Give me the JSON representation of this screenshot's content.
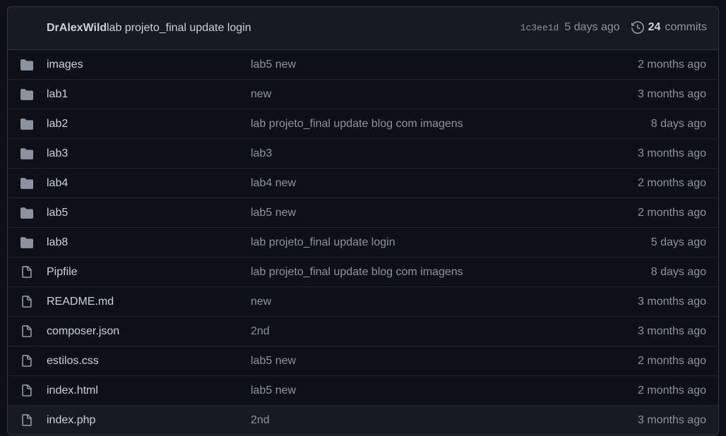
{
  "header": {
    "author": "DrAlexWild",
    "message": "lab projeto_final update login",
    "sha": "1c3ee1d",
    "age": "5 days ago",
    "commit_count": "24",
    "commits_label": "commits"
  },
  "colors": {
    "background": "#0d1117",
    "header_bg": "#161b22",
    "border": "#30363d",
    "text": "#c9d1d9",
    "muted": "#8b949e",
    "icon": "#8b949e"
  },
  "files": [
    {
      "type": "folder-icon",
      "name": "images",
      "message": "lab5 new",
      "time": "2 months ago"
    },
    {
      "type": "folder-icon",
      "name": "lab1",
      "message": "new",
      "time": "3 months ago"
    },
    {
      "type": "folder-icon",
      "name": "lab2",
      "message": "lab projeto_final update blog com imagens",
      "time": "8 days ago"
    },
    {
      "type": "folder-icon",
      "name": "lab3",
      "message": "lab3",
      "time": "3 months ago"
    },
    {
      "type": "folder-icon",
      "name": "lab4",
      "message": "lab4 new",
      "time": "2 months ago"
    },
    {
      "type": "folder-icon",
      "name": "lab5",
      "message": "lab5 new",
      "time": "2 months ago"
    },
    {
      "type": "folder-icon",
      "name": "lab8",
      "message": "lab projeto_final update login",
      "time": "5 days ago"
    },
    {
      "type": "file-icon",
      "name": "Pipfile",
      "message": "lab projeto_final update blog com imagens",
      "time": "8 days ago"
    },
    {
      "type": "file-icon",
      "name": "README.md",
      "message": "new",
      "time": "3 months ago"
    },
    {
      "type": "file-icon",
      "name": "composer.json",
      "message": "2nd",
      "time": "3 months ago"
    },
    {
      "type": "file-icon",
      "name": "estilos.css",
      "message": "lab5 new",
      "time": "2 months ago"
    },
    {
      "type": "file-icon",
      "name": "index.html",
      "message": "lab5 new",
      "time": "2 months ago"
    },
    {
      "type": "file-icon",
      "name": "index.php",
      "message": "2nd",
      "time": "3 months ago"
    }
  ]
}
